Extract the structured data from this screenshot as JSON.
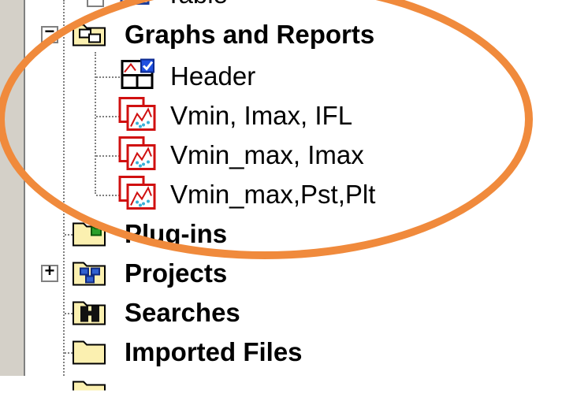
{
  "tree": {
    "partial_item": {
      "label": "Table"
    },
    "groups": [
      {
        "label": "Graphs and Reports",
        "expanded": true,
        "children": [
          {
            "label": "Header",
            "icon": "report-header-icon"
          },
          {
            "label": "Vmin, Imax, IFL",
            "icon": "graph-report-icon"
          },
          {
            "label": "Vmin_max, Imax",
            "icon": "graph-report-icon"
          },
          {
            "label": "Vmin_max,Pst,Plt",
            "icon": "graph-report-icon"
          }
        ]
      },
      {
        "label": "Plug-ins",
        "icon": "plugin-folder-icon"
      },
      {
        "label": "Projects",
        "icon": "projects-folder-icon",
        "expander": "+"
      },
      {
        "label": "Searches",
        "icon": "binoculars-icon"
      },
      {
        "label": "Imported Files",
        "icon": "folder-icon"
      }
    ]
  },
  "colors": {
    "annotation": "#f08a3c",
    "tree_line": "#808080",
    "panel_gutter": "#d4d0c8"
  }
}
